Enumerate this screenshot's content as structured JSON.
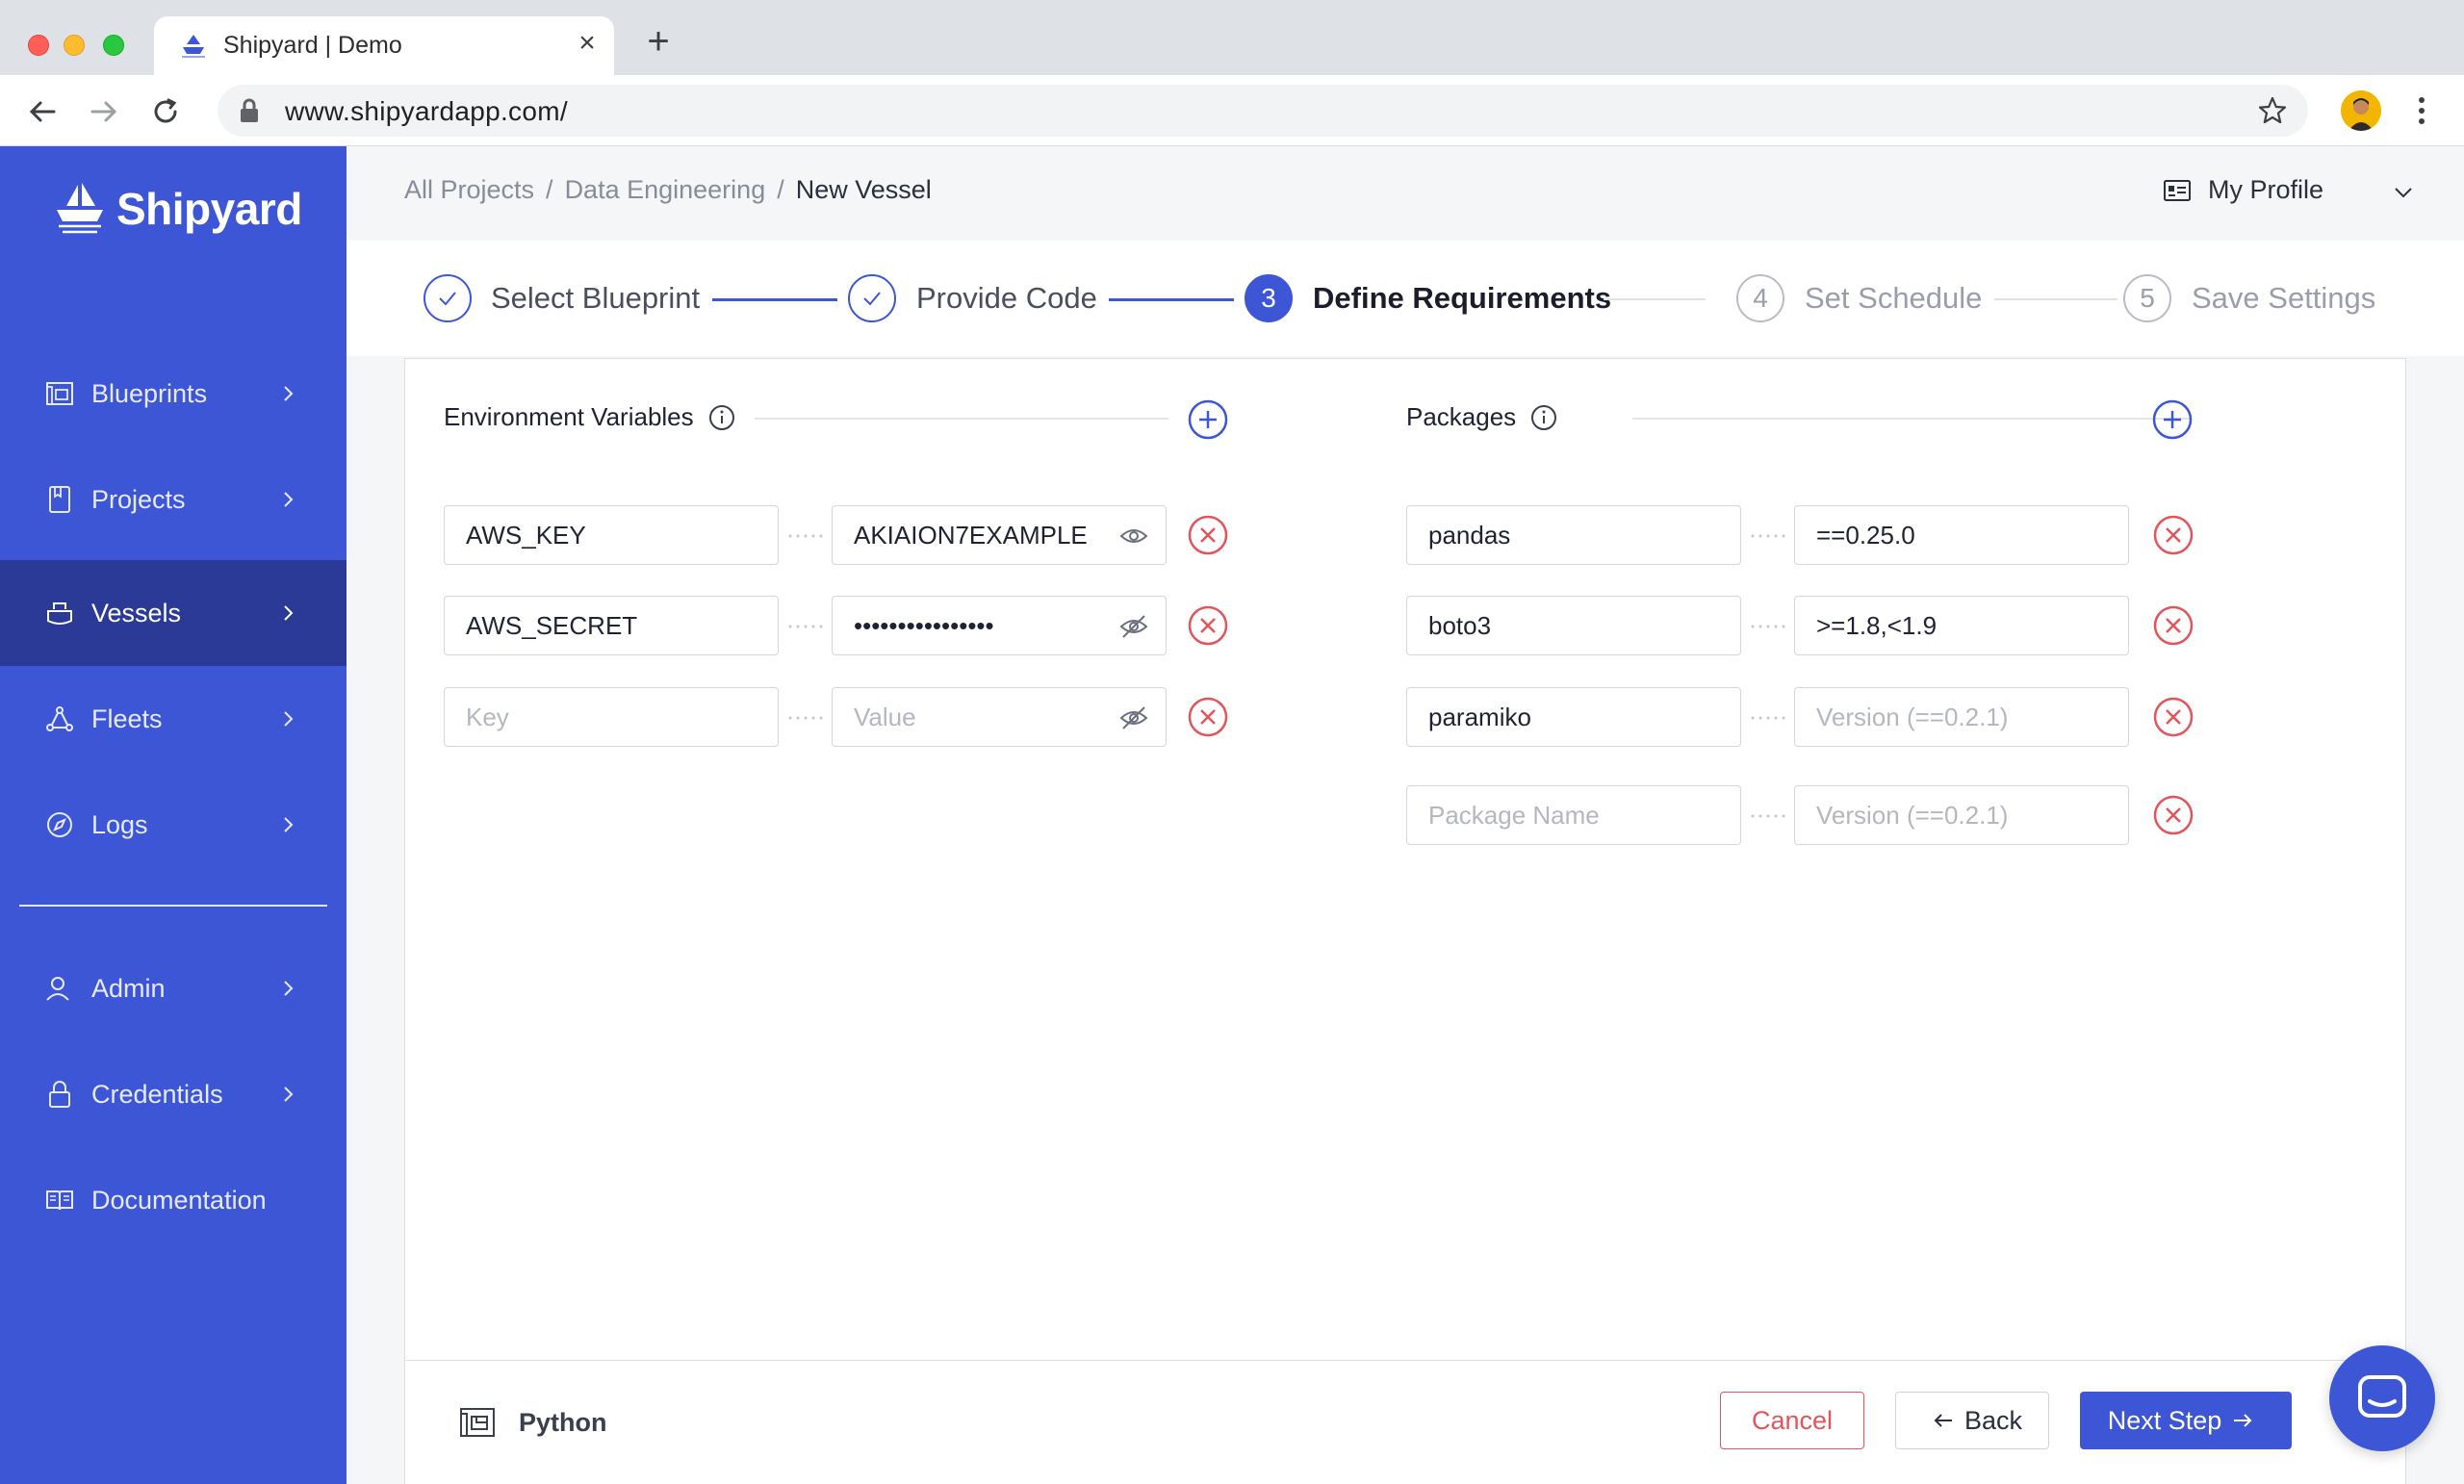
{
  "browser": {
    "tab_title": "Shipyard | Demo",
    "url": "www.shipyardapp.com/"
  },
  "sidebar": {
    "logo_text": "Shipyard",
    "items": [
      {
        "label": "Blueprints",
        "icon": "blueprint-icon"
      },
      {
        "label": "Projects",
        "icon": "document-icon"
      },
      {
        "label": "Vessels",
        "icon": "vessel-icon",
        "active": true
      },
      {
        "label": "Fleets",
        "icon": "fleet-icon"
      },
      {
        "label": "Logs",
        "icon": "compass-icon"
      },
      {
        "label": "Admin",
        "icon": "user-icon"
      },
      {
        "label": "Credentials",
        "icon": "lock-icon"
      },
      {
        "label": "Documentation",
        "icon": "book-icon"
      }
    ]
  },
  "header": {
    "breadcrumb": [
      "All Projects",
      "Data Engineering",
      "New Vessel"
    ],
    "profile_label": "My Profile"
  },
  "steps": [
    {
      "number": "1",
      "label": "Select Blueprint",
      "state": "done"
    },
    {
      "number": "2",
      "label": "Provide Code",
      "state": "done"
    },
    {
      "number": "3",
      "label": "Define Requirements",
      "state": "active"
    },
    {
      "number": "4",
      "label": "Set Schedule",
      "state": "todo"
    },
    {
      "number": "5",
      "label": "Save Settings",
      "state": "todo"
    }
  ],
  "env": {
    "title": "Environment Variables",
    "rows": [
      {
        "key": "AWS_KEY",
        "value": "AKIAION7EXAMPLE",
        "visible": true
      },
      {
        "key": "AWS_SECRET",
        "value": "••••••••••••••••",
        "visible": false
      },
      {
        "key": "",
        "value": "",
        "visible": false
      }
    ],
    "key_placeholder": "Key",
    "value_placeholder": "Value"
  },
  "packages": {
    "title": "Packages",
    "rows": [
      {
        "name": "pandas",
        "version": "==0.25.0"
      },
      {
        "name": "boto3",
        "version": ">=1.8,<1.9"
      },
      {
        "name": "paramiko",
        "version": ""
      },
      {
        "name": "",
        "version": ""
      }
    ],
    "name_placeholder": "Package Name",
    "version_placeholder": "Version (==0.2.1)"
  },
  "footer": {
    "language": "Python",
    "cancel_label": "Cancel",
    "back_label": "Back",
    "next_label": "Next Step"
  },
  "colors": {
    "brand": "#3d56d6",
    "sidebar_active": "#2a3a96",
    "danger": "#e2555b"
  }
}
